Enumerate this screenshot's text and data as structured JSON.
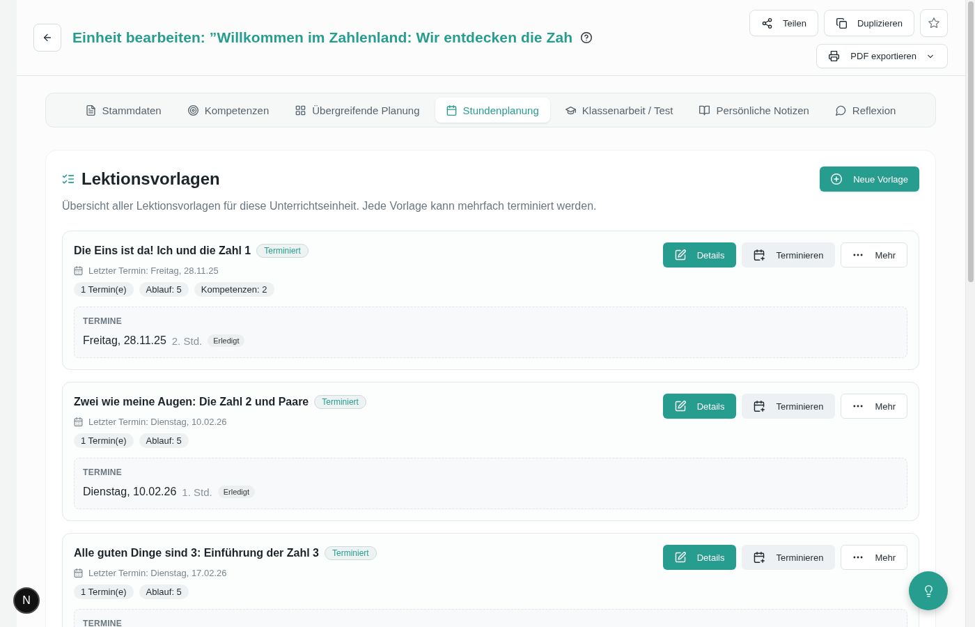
{
  "header": {
    "title": "Einheit bearbeiten: ”Willkommen im Zahlenland: Wir entdecken die Zah",
    "actions": [
      {
        "kind": "share",
        "label": "Teilen"
      },
      {
        "kind": "duplicate",
        "label": "Duplizieren"
      },
      {
        "kind": "favorite"
      },
      {
        "kind": "export",
        "label": "PDF exportieren"
      }
    ]
  },
  "tabs": [
    {
      "kind": "document",
      "label": "Stammdaten",
      "selected": false
    },
    {
      "kind": "target",
      "label": "Kompetenzen",
      "selected": false
    },
    {
      "kind": "grid",
      "label": "Übergreifende Planung",
      "selected": false
    },
    {
      "kind": "calendar",
      "label": "Stundenplanung",
      "selected": true
    },
    {
      "kind": "cap",
      "label": "Klassenarbeit / Test",
      "selected": false
    },
    {
      "kind": "book",
      "label": "Persönliche Notizen",
      "selected": false
    },
    {
      "kind": "chat",
      "label": "Reflexion",
      "selected": false
    }
  ],
  "section": {
    "title": "Lektionsvorlagen",
    "description": "Übersicht aller Lektionsvorlagen für diese Unterrichtseinheit. Jede Vorlage kann mehrfach terminiert werden.",
    "new_button": "Neue Vorlage"
  },
  "lessons": [
    {
      "title": "Die Eins ist da! Ich und die Zahl 1",
      "status": "Terminiert",
      "last_date": "Letzter Termin: Freitag, 28.11.25",
      "chips": [
        "1 Termin(e)",
        "Ablauf: 5",
        "Kompetenzen: 2"
      ],
      "actions": [
        {
          "kind": "edit",
          "label": "Details"
        },
        {
          "kind": "schedule",
          "label": "Terminieren"
        },
        {
          "kind": "more",
          "label": "Mehr"
        }
      ],
      "appointments_label": "TERMINE",
      "appointments": [
        {
          "date": "Freitag, 28.11.25",
          "period": "2. Std.",
          "status": "Erledigt"
        }
      ]
    },
    {
      "title": "Zwei wie meine Augen: Die Zahl 2 und Paare",
      "status": "Terminiert",
      "last_date": "Letzter Termin: Dienstag, 10.02.26",
      "chips": [
        "1 Termin(e)",
        "Ablauf: 5"
      ],
      "actions": [
        {
          "kind": "edit",
          "label": "Details"
        },
        {
          "kind": "schedule",
          "label": "Terminieren"
        },
        {
          "kind": "more",
          "label": "Mehr"
        }
      ],
      "appointments_label": "TERMINE",
      "appointments": [
        {
          "date": "Dienstag, 10.02.26",
          "period": "1. Std.",
          "status": "Erledigt"
        }
      ]
    },
    {
      "title": "Alle guten Dinge sind 3: Einführung der Zahl 3",
      "status": "Terminiert",
      "last_date": "Letzter Termin: Dienstag, 17.02.26",
      "chips": [
        "1 Termin(e)",
        "Ablauf: 5"
      ],
      "actions": [
        {
          "kind": "edit",
          "label": "Details"
        },
        {
          "kind": "schedule",
          "label": "Terminieren"
        },
        {
          "kind": "more",
          "label": "Mehr"
        }
      ],
      "appointments_label": "TERMINE"
    }
  ],
  "dev_badge": {
    "label": "N"
  }
}
